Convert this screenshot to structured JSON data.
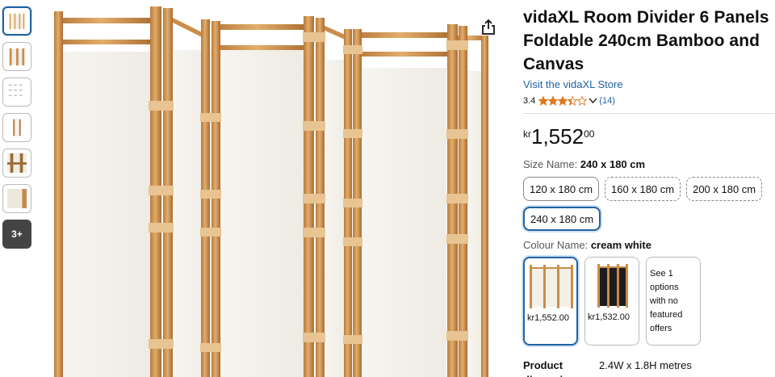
{
  "gallery": {
    "more_label": "3+",
    "thumbnails": [
      "cream-panels",
      "panel-detail",
      "size-chart",
      "single-panel",
      "frame-closeup",
      "fabric-swatch"
    ]
  },
  "product": {
    "title": "vidaXL Room Divider 6 Panels Foldable 240cm Bamboo and Canvas",
    "store_link": "Visit the vidaXL Store",
    "rating": "3.4",
    "rating_value": 3.4,
    "review_count": "(14)",
    "price": {
      "symbol": "kr",
      "whole": "1,552",
      "fraction": "00"
    },
    "size": {
      "label": "Size Name:",
      "selected": "240 x 180 cm",
      "options": [
        "120 x 180 cm",
        "160 x 180 cm",
        "200 x 180 cm",
        "240 x 180 cm"
      ]
    },
    "colour": {
      "label": "Colour Name:",
      "selected": "cream white",
      "options": [
        {
          "price": "kr1,552.00",
          "swatch": "cream"
        },
        {
          "price": "kr1,532.00",
          "swatch": "black"
        }
      ],
      "more_text": "See 1 options with no featured offers"
    },
    "dimensions": {
      "label": "Product dimensions",
      "value": "2.4W x 1.8H metres"
    }
  },
  "colors": {
    "link": "#2162a1",
    "star": "#de7921",
    "selected_border": "#2162a1",
    "bamboo": "#d9a05b",
    "canvas": "#f3f0e8"
  }
}
